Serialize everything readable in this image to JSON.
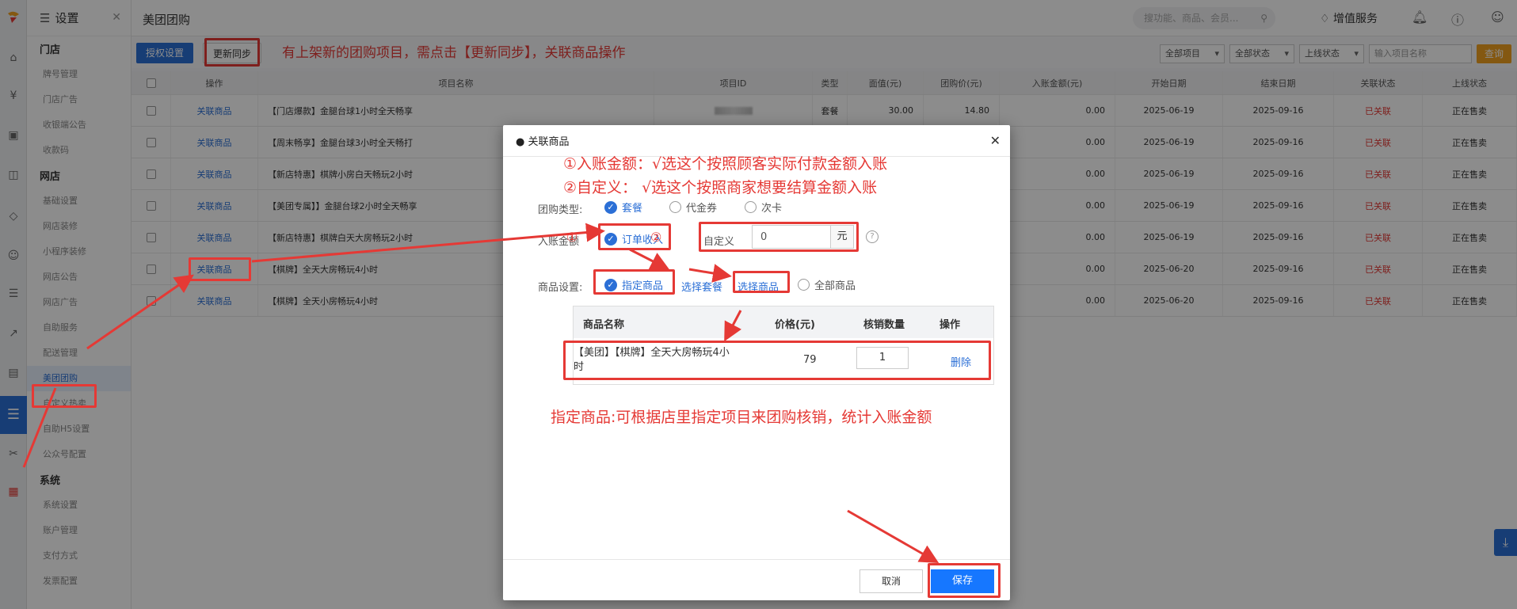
{
  "sidebar": {
    "title": "设置",
    "sections": [
      {
        "title": "门店",
        "items": [
          "牌号管理",
          "门店广告",
          "收银端公告",
          "收款码"
        ]
      },
      {
        "title": "网店",
        "items": [
          "基础设置",
          "网店装修",
          "小程序装修",
          "网店公告",
          "网店广告",
          "自助服务",
          "配送管理",
          "美团团购",
          "自定义热卖",
          "自助H5设置",
          "公众号配置"
        ]
      },
      {
        "title": "系统",
        "items": [
          "系统设置",
          "账户管理",
          "支付方式",
          "发票配置"
        ]
      }
    ]
  },
  "header": {
    "page_title": "美团团购",
    "search_placeholder": "搜功能、商品、会员...",
    "value_added": "增值服务"
  },
  "toolbar": {
    "auth_button": "授权设置",
    "sync_button": "更新同步",
    "annotation": "有上架新的团购项目，需点击【更新同步】，关联商品操作",
    "filters": [
      "全部项目",
      "全部状态",
      "上线状态"
    ],
    "search_placeholder": "输入项目名称",
    "query_button": "查询"
  },
  "table": {
    "columns": [
      "操作",
      "项目名称",
      "项目ID",
      "类型",
      "面值(元)",
      "团购价(元)",
      "入账金额(元)",
      "开始日期",
      "结束日期",
      "关联状态",
      "上线状态"
    ],
    "rows": [
      {
        "action": "关联商品",
        "name": "【门店爆款】金腿台球1小时全天畅享",
        "type": "套餐",
        "face": "30.00",
        "price": "14.80",
        "amount": "0.00",
        "start": "2025-06-19",
        "end": "2025-09-16",
        "link": "已关联",
        "online": "正在售卖"
      },
      {
        "action": "关联商品",
        "name": "【周末畅享】金腿台球3小时全天畅打",
        "type": "",
        "face": "",
        "price": "",
        "amount": "0.00",
        "start": "2025-06-19",
        "end": "2025-09-16",
        "link": "已关联",
        "online": "正在售卖"
      },
      {
        "action": "关联商品",
        "name": "【新店特惠】棋牌小房白天畅玩2小时",
        "type": "",
        "face": "",
        "price": "",
        "amount": "0.00",
        "start": "2025-06-19",
        "end": "2025-09-16",
        "link": "已关联",
        "online": "正在售卖"
      },
      {
        "action": "关联商品",
        "name": "【美团专属】】金腿台球2小时全天畅享",
        "type": "",
        "face": "",
        "price": "",
        "amount": "0.00",
        "start": "2025-06-19",
        "end": "2025-09-16",
        "link": "已关联",
        "online": "正在售卖"
      },
      {
        "action": "关联商品",
        "name": "【新店特惠】棋牌白天大房畅玩2小时",
        "type": "",
        "face": "",
        "price": "",
        "amount": "0.00",
        "start": "2025-06-19",
        "end": "2025-09-16",
        "link": "已关联",
        "online": "正在售卖"
      },
      {
        "action": "关联商品",
        "name": "【棋牌】全天大房畅玩4小时",
        "type": "",
        "face": "",
        "price": "",
        "amount": "0.00",
        "start": "2025-06-20",
        "end": "2025-09-16",
        "link": "已关联",
        "online": "正在售卖"
      },
      {
        "action": "关联商品",
        "name": "【棋牌】全天小房畅玩4小时",
        "type": "",
        "face": "",
        "price": "",
        "amount": "0.00",
        "start": "2025-06-20",
        "end": "2025-09-16",
        "link": "已关联",
        "online": "正在售卖"
      }
    ]
  },
  "modal": {
    "title": "● 关联商品",
    "note1": "①入账金额：√选这个按照顾客实际付款金额入账",
    "note2": "②自定义：  √选这个按照商家想要结算金额入账",
    "type_label": "团购类型:",
    "type_options": [
      "套餐",
      "代金券",
      "次卡"
    ],
    "amount_label": "入账金额",
    "marker1": "①",
    "marker2": "②",
    "order_income": "订单收入",
    "custom_label": "自定义",
    "custom_value": "0",
    "unit": "元",
    "help": "?",
    "goods_label": "商品设置:",
    "goods_options": [
      "指定商品",
      "选择套餐",
      "选择商品",
      "全部商品"
    ],
    "product_table": {
      "columns": [
        "商品名称",
        "价格(元)",
        "核销数量",
        "操作"
      ],
      "row": {
        "name": "【美团】【棋牌】全天大房畅玩4小时",
        "price": "79",
        "qty": "1",
        "action": "删除"
      }
    },
    "bottom_note": "指定商品:可根据店里指定项目来团购核销，统计入账金额",
    "cancel": "取消",
    "save": "保存"
  },
  "colors": {
    "brand": "#2b6fd6",
    "annotation": "#e53935",
    "save": "#1677ff",
    "query": "#f0a020"
  }
}
